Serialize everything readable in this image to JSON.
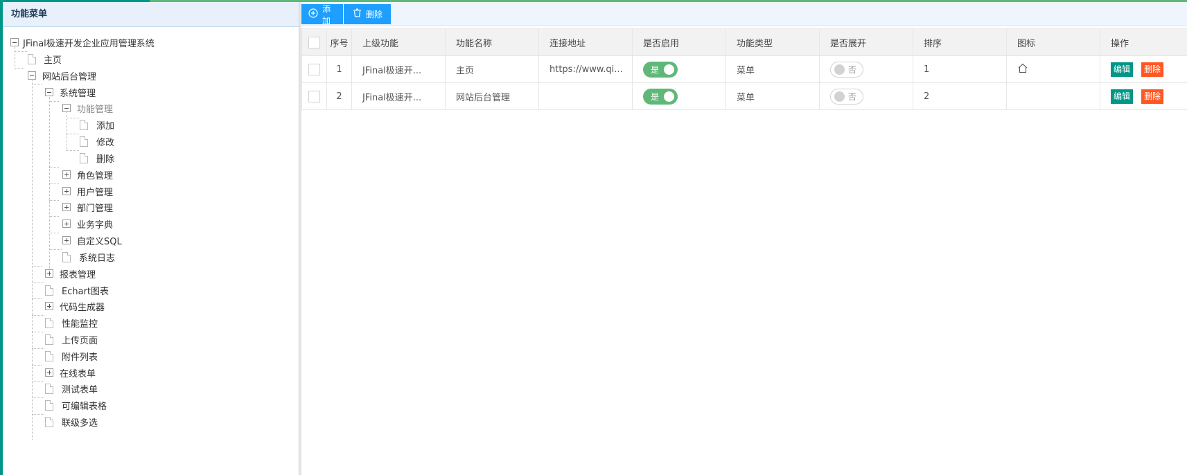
{
  "left_panel": {
    "title": "功能菜单",
    "tree": [
      {
        "label": "JFinal极速开发企业应用管理系统",
        "type": "minus"
      },
      {
        "label": "主页",
        "type": "doc"
      },
      {
        "label": "网站后台管理",
        "type": "minus"
      },
      {
        "label": "系统管理",
        "type": "minus"
      },
      {
        "label": "功能管理",
        "type": "minus"
      },
      {
        "label": "添加",
        "type": "doc"
      },
      {
        "label": "修改",
        "type": "doc"
      },
      {
        "label": "删除",
        "type": "doc"
      },
      {
        "label": "角色管理",
        "type": "plus"
      },
      {
        "label": "用户管理",
        "type": "plus"
      },
      {
        "label": "部门管理",
        "type": "plus"
      },
      {
        "label": "业务字典",
        "type": "plus"
      },
      {
        "label": "自定义SQL",
        "type": "plus"
      },
      {
        "label": "系统日志",
        "type": "doc"
      },
      {
        "label": "报表管理",
        "type": "plus"
      },
      {
        "label": "Echart图表",
        "type": "doc"
      },
      {
        "label": "代码生成器",
        "type": "plus"
      },
      {
        "label": "性能监控",
        "type": "doc"
      },
      {
        "label": "上传页面",
        "type": "doc"
      },
      {
        "label": "附件列表",
        "type": "doc"
      },
      {
        "label": "在线表单",
        "type": "plus"
      },
      {
        "label": "测试表单",
        "type": "doc"
      },
      {
        "label": "可编辑表格",
        "type": "doc"
      },
      {
        "label": "联级多选",
        "type": "doc"
      }
    ]
  },
  "toolbar": {
    "add_label": "添加",
    "delete_label": "删除",
    "add_icon": "plus-circle-icon",
    "delete_icon": "trash-icon"
  },
  "table": {
    "columns": [
      "序号",
      "上级功能",
      "功能名称",
      "连接地址",
      "是否启用",
      "功能类型",
      "是否展开",
      "排序",
      "图标",
      "操作"
    ],
    "rows": [
      {
        "index": "1",
        "parent": "JFinal极速开...",
        "name": "主页",
        "url": "https://www.qi...",
        "enabled": "是",
        "type": "菜单",
        "expanded": "否",
        "sort": "1",
        "icon": "home-icon",
        "edit": "编辑",
        "delete": "删除"
      },
      {
        "index": "2",
        "parent": "JFinal极速开...",
        "name": "网站后台管理",
        "url": "",
        "enabled": "是",
        "type": "菜单",
        "expanded": "否",
        "sort": "2",
        "icon": "",
        "edit": "编辑",
        "delete": "删除"
      }
    ]
  },
  "colors": {
    "accent": "#009688",
    "primary_button": "#1e9fff",
    "danger": "#ff5722",
    "switch_on": "#5fb878"
  }
}
